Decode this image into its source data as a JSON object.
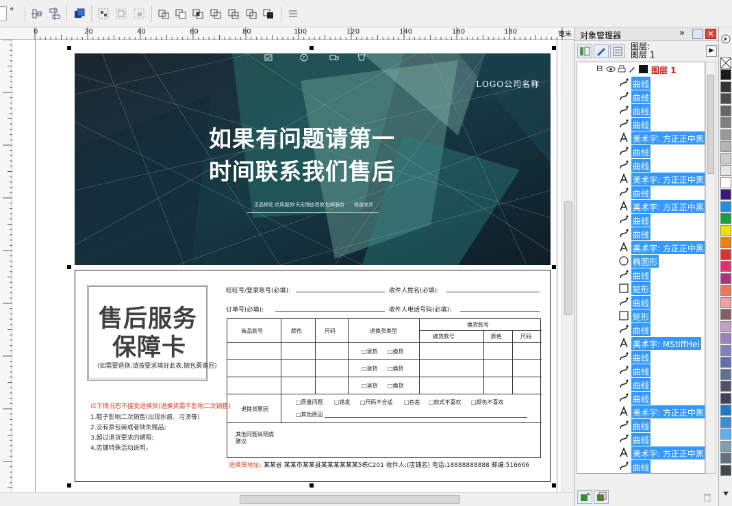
{
  "toolbar": {
    "degree_symbol": "°",
    "icons": [
      "align-icon",
      "distribute-icon",
      "order-icon",
      "group-icon",
      "ungroup-icon",
      "ungroup-all-icon",
      "weld-icon",
      "trim-icon",
      "intersect-icon",
      "simplify-icon",
      "front-minus-back-icon",
      "back-minus-front-icon",
      "boundary-icon",
      "convert-to-curves-icon"
    ]
  },
  "ruler": {
    "ticks": [
      "0",
      "20",
      "40",
      "60",
      "80",
      "100",
      "120",
      "140",
      "160",
      "180"
    ],
    "unit": "毫米"
  },
  "banner": {
    "logo_text": "LOGO公司名称",
    "headline_line1": "如果有问题请第一",
    "headline_line2": "时间联系我们售后",
    "features": [
      "正品保证 优质服务",
      "7天无理由退换",
      "包邮服务",
      "极速发货"
    ],
    "bg_color": "#0f1c26",
    "accent_color": "#2a6d6a"
  },
  "card": {
    "title_line1": "售后服务",
    "title_line2": "保障卡",
    "title_note": "(如需要退换,请按要求填好此表,随包裹寄回)",
    "policy_heading": "以下情况恕不接受退换货(退换货需不影响二次销售)",
    "policy_items": [
      "1.鞋子影响二次销售(出现折痕、污渍等)",
      "2.没有原包装或者缺失赠品;",
      "3.超过退货要求的期限;",
      "4.店铺特殊活动说明。"
    ],
    "fields": {
      "account": "旺旺号/登录账号(必填):",
      "recipient": "收件人姓名(必填):",
      "order": "订单号(必填):",
      "phone": "收件人电话号码(必填):"
    },
    "table": {
      "exchange_group": "换货款号",
      "headers": [
        "商品款号",
        "颜色",
        "尺码",
        "退换货类型",
        "换货款号",
        "颜色",
        "尺码"
      ],
      "return_type_options": [
        "□退货",
        "□换货"
      ],
      "reason_label": "退换货原因",
      "reasons": [
        "□质量问题",
        "□错发",
        "□尺码不合适",
        "□色差",
        "□款式不喜欢",
        "□颜色不喜欢"
      ],
      "other_reason": "□其他原因",
      "remarks_label": "其他问题说明或建议"
    },
    "footer_label": "退换货地址:",
    "footer_text": "某某省 某某市某某县某某某某某某5栋C201 收件人:(店铺名) 电话:18888888888 邮编:516666"
  },
  "docker": {
    "title": "对象管理器",
    "expand_glyph": "»",
    "close_glyph": "✕",
    "layer_label_line1": "图层:",
    "layer_label_line2": "图层 1",
    "arrow_glyph": "▶",
    "tree_layer_toggle": "⊟",
    "tree_layer_name": "图层 1",
    "tree_items": [
      {
        "icon": "curve-icon",
        "label": "曲线"
      },
      {
        "icon": "curve-icon",
        "label": "曲线"
      },
      {
        "icon": "curve-icon",
        "label": "曲线"
      },
      {
        "icon": "curve-icon",
        "label": "曲线"
      },
      {
        "icon": "artistic-text-icon",
        "label": "美术字: 方正正中黑"
      },
      {
        "icon": "curve-icon",
        "label": "曲线"
      },
      {
        "icon": "curve-icon",
        "label": "曲线"
      },
      {
        "icon": "artistic-text-icon",
        "label": "美术字: 方正正中黑"
      },
      {
        "icon": "curve-icon",
        "label": "曲线"
      },
      {
        "icon": "artistic-text-icon",
        "label": "美术字: 方正正中黑"
      },
      {
        "icon": "curve-icon",
        "label": "曲线"
      },
      {
        "icon": "curve-icon",
        "label": "曲线"
      },
      {
        "icon": "artistic-text-icon",
        "label": "美术字: 方正正中黑"
      },
      {
        "icon": "ellipse-icon",
        "label": "椭圆形"
      },
      {
        "icon": "curve-icon",
        "label": "曲线"
      },
      {
        "icon": "rectangle-icon",
        "label": "矩形"
      },
      {
        "icon": "curve-icon",
        "label": "曲线"
      },
      {
        "icon": "rectangle-icon",
        "label": "矩形"
      },
      {
        "icon": "curve-icon",
        "label": "曲线"
      },
      {
        "icon": "artistic-text-icon",
        "label": "美术字: MStiffHei"
      },
      {
        "icon": "curve-icon",
        "label": "曲线"
      },
      {
        "icon": "curve-icon",
        "label": "曲线"
      },
      {
        "icon": "curve-icon",
        "label": "曲线"
      },
      {
        "icon": "curve-icon",
        "label": "曲线"
      },
      {
        "icon": "artistic-text-icon",
        "label": "美术字: 方正正中黑"
      },
      {
        "icon": "curve-icon",
        "label": "曲线"
      },
      {
        "icon": "curve-icon",
        "label": "曲线"
      },
      {
        "icon": "artistic-text-icon",
        "label": "美术字: 方正正中黑"
      },
      {
        "icon": "curve-icon",
        "label": "曲线"
      }
    ]
  },
  "palette": {
    "colors": [
      "#1a1a1a",
      "#333333",
      "#4d4d4d",
      "#666666",
      "#808080",
      "#999999",
      "#b3b3b3",
      "#cccccc",
      "#e6e6e6",
      "#ffffff",
      "#3d1a78",
      "#1f8fe0",
      "#1a9e3a",
      "#f0e010",
      "#f08010",
      "#e03030",
      "#e0306e",
      "#b03080",
      "#f07858",
      "#f0a0a0",
      "#806060",
      "#c0a0c0",
      "#a080c0",
      "#8080c0",
      "#6070b0",
      "#607090",
      "#505068",
      "#404058",
      "#1e78c8",
      "#3a8ed8",
      "#60b0f0",
      "#80a0b0",
      "#607080",
      "#404850"
    ]
  }
}
